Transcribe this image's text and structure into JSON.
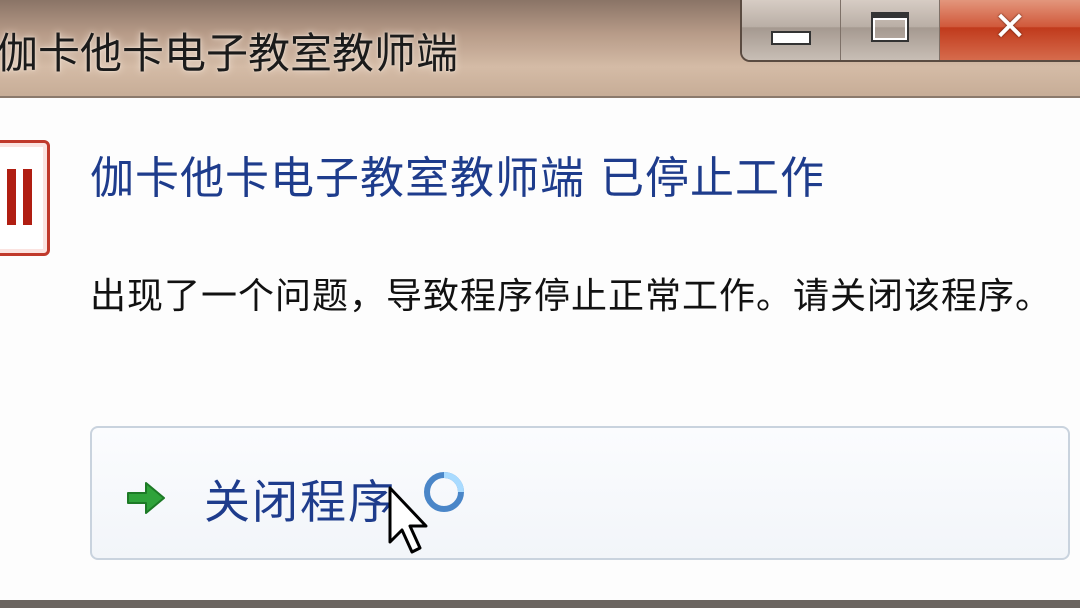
{
  "window": {
    "title": "伽卡他卡电子教室教师端",
    "controls": {
      "minimize_icon": "minimize-icon",
      "maximize_icon": "maximize-icon",
      "close_icon": "close-icon",
      "close_glyph": "✕"
    }
  },
  "dialog": {
    "app_icon": "app-error-icon",
    "heading": "伽卡他卡电子教室教师端 已停止工作",
    "message": "出现了一个问题，导致程序停止正常工作。请关闭该程序。",
    "command": {
      "icon": "green-arrow-icon",
      "label": "关闭程序"
    }
  },
  "cursor": {
    "state": "busy",
    "icons": [
      "pointer-cursor-icon",
      "busy-spinner-icon"
    ]
  },
  "colors": {
    "heading": "#1e3c8c",
    "close_button": "#c03a1c",
    "arrow": "#2fa33a"
  }
}
